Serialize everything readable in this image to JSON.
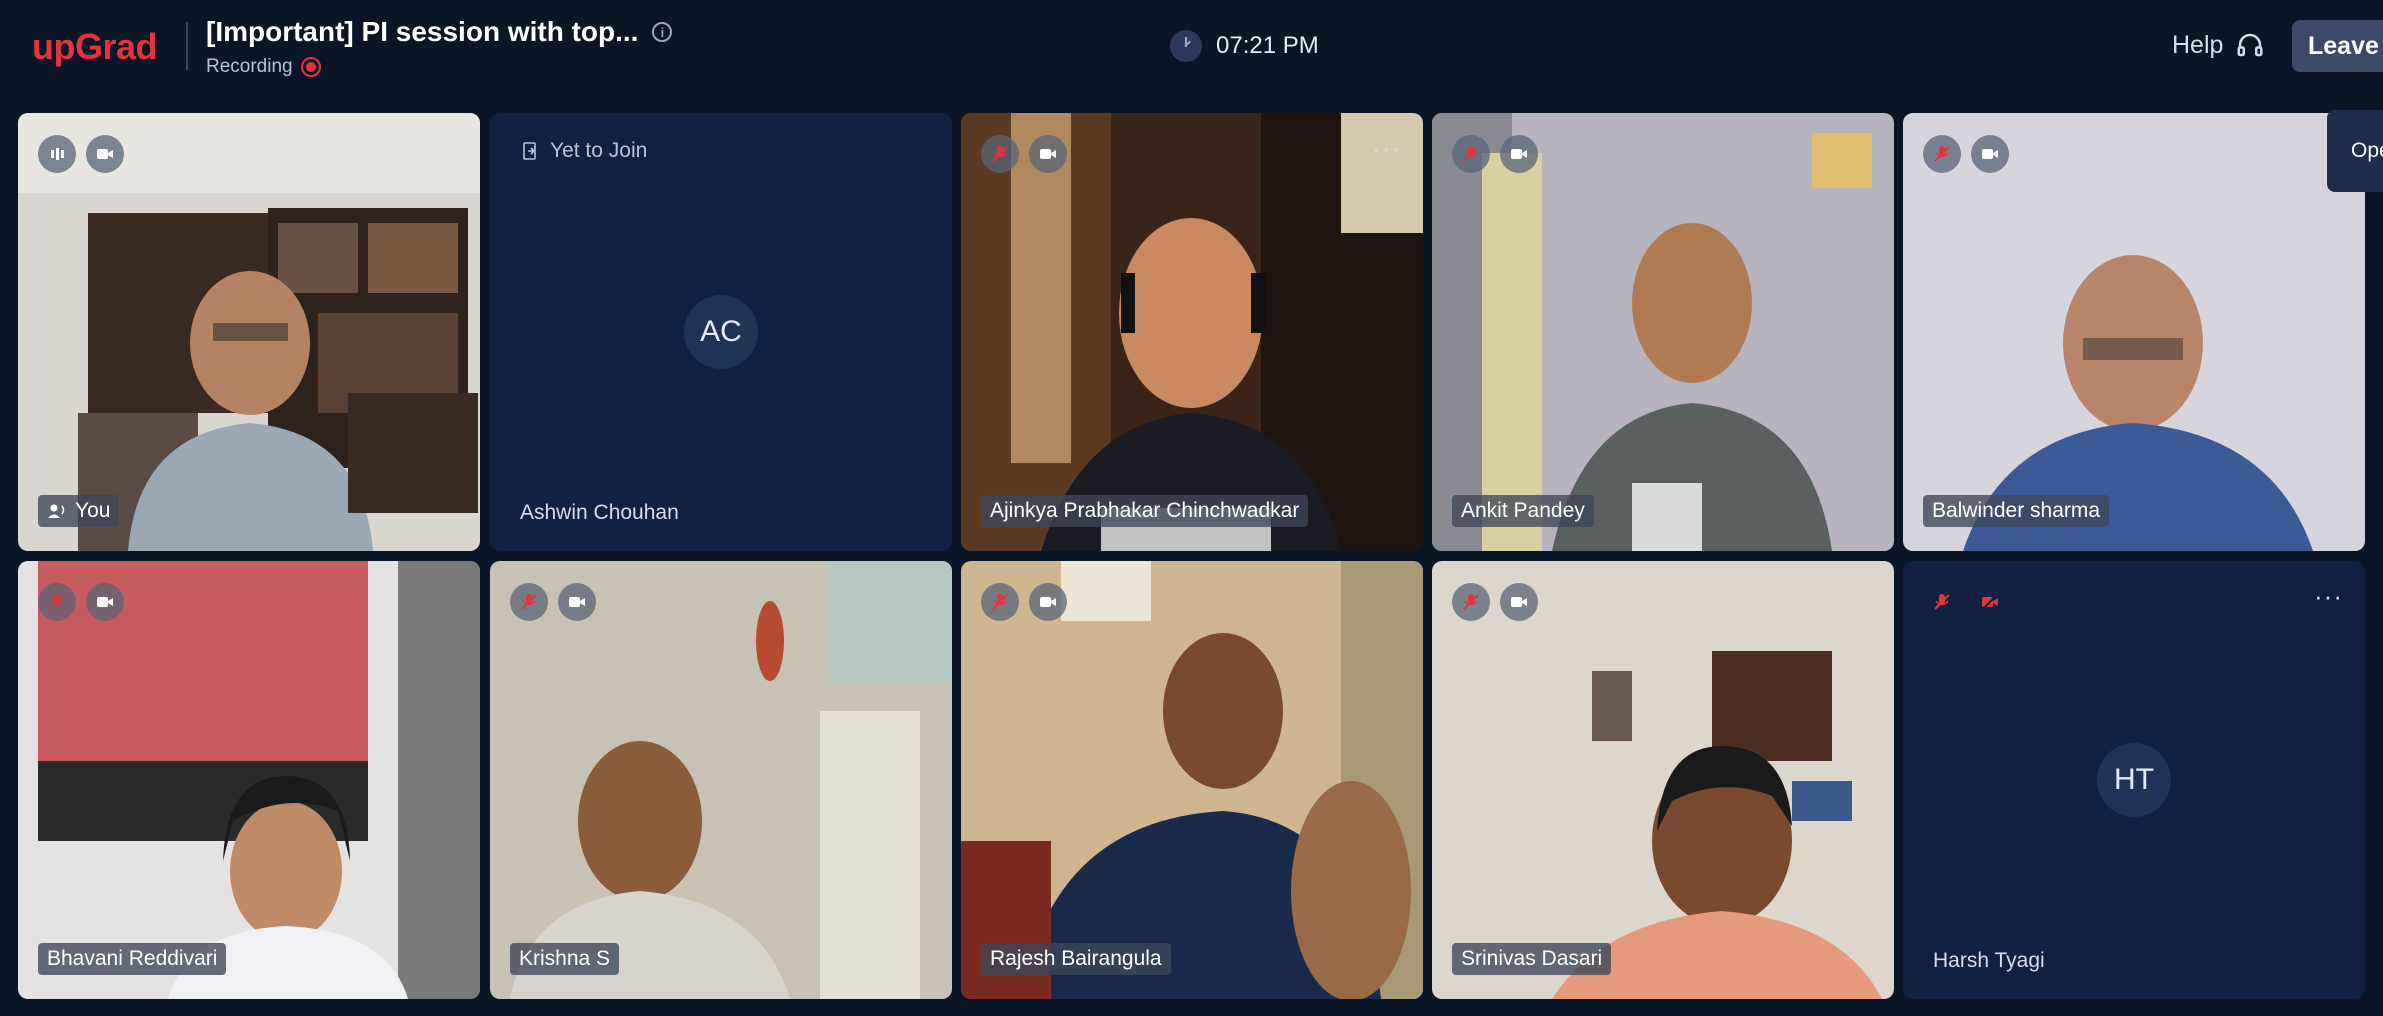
{
  "header": {
    "logo": "upGrad",
    "title": "[Important] PI session with top...",
    "recording_label": "Recording",
    "time": "07:21 PM",
    "help_label": "Help",
    "leave_label": "Leave",
    "open_tab_label": "Ope"
  },
  "colors": {
    "brand": "#e5333b",
    "background": "#0a1628",
    "tile_empty": "#0f2140"
  },
  "participants": [
    {
      "name": "You",
      "mic": "speaking",
      "camera": "on",
      "video": true
    },
    {
      "name": "Ashwin Chouhan",
      "status": "Yet to Join",
      "initials": "AC",
      "video": false
    },
    {
      "name": "Ajinkya Prabhakar Chinchwadkar",
      "mic": "muted",
      "camera": "on",
      "video": true
    },
    {
      "name": "Ankit Pandey",
      "mic": "muted",
      "camera": "on",
      "video": true
    },
    {
      "name": "Balwinder sharma",
      "mic": "muted",
      "camera": "on",
      "video": true
    },
    {
      "name": "Bhavani Reddivari",
      "mic": "muted",
      "camera": "on",
      "video": true
    },
    {
      "name": "Krishna S",
      "mic": "muted",
      "camera": "on",
      "video": true
    },
    {
      "name": "Rajesh Bairangula",
      "mic": "muted",
      "camera": "on",
      "video": true
    },
    {
      "name": "Srinivas Dasari",
      "mic": "muted",
      "camera": "on",
      "video": true
    },
    {
      "name": "Harsh Tyagi",
      "mic": "muted",
      "camera": "off",
      "initials": "HT",
      "video": false
    }
  ]
}
